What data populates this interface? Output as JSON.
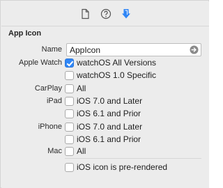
{
  "section": {
    "title": "App Icon"
  },
  "name_field": {
    "label": "Name",
    "value": "AppIcon"
  },
  "platforms": [
    {
      "label": "Apple Watch",
      "options": [
        {
          "label": "watchOS All Versions",
          "checked": true
        },
        {
          "label": "watchOS 1.0 Specific",
          "checked": false
        }
      ]
    },
    {
      "label": "CarPlay",
      "options": [
        {
          "label": "All",
          "checked": false
        }
      ]
    },
    {
      "label": "iPad",
      "options": [
        {
          "label": "iOS 7.0 and Later",
          "checked": false
        },
        {
          "label": "iOS 6.1 and Prior",
          "checked": false
        }
      ]
    },
    {
      "label": "iPhone",
      "options": [
        {
          "label": "iOS 7.0 and Later",
          "checked": false
        },
        {
          "label": "iOS 6.1 and Prior",
          "checked": false
        }
      ]
    },
    {
      "label": "Mac",
      "options": [
        {
          "label": "All",
          "checked": false
        }
      ]
    }
  ],
  "prerendered": {
    "label": "iOS icon is pre-rendered",
    "checked": false
  },
  "icons": {
    "tabs": [
      "file-inspector-icon",
      "quick-help-icon",
      "attributes-inspector-icon"
    ],
    "name_action": "go-arrow-icon"
  },
  "colors": {
    "accent": "#2f86f6",
    "panel": "#ececec"
  }
}
